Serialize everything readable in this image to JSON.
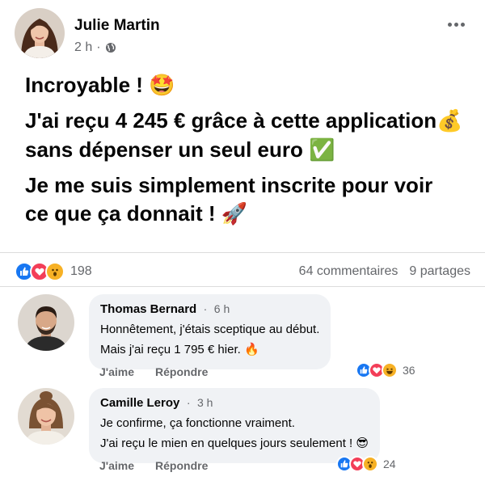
{
  "post": {
    "author": "Julie Martin",
    "time": "2 h",
    "separator": "·",
    "icons": {
      "privacy": "globe-icon",
      "menu": "more-options-icon"
    },
    "lines": [
      {
        "text": "Incroyable ! ",
        "emoji": "🤩"
      },
      {
        "text": "J'ai reçu 4 245 € grâce à cette application",
        "emoji": "💰"
      },
      {
        "text": "sans dépenser un seul euro ",
        "emoji": "✅"
      },
      {
        "text": "Je me suis simplement inscrite pour voir",
        "emoji": ""
      },
      {
        "text": "ce que ça donnait ! ",
        "emoji": "🚀"
      }
    ]
  },
  "reactions": {
    "icons": [
      "like-icon",
      "love-icon",
      "wow-icon"
    ],
    "count": "198",
    "comments": "64 commentaires",
    "shares": "9 partages"
  },
  "comments": [
    {
      "name": "Thomas Bernard",
      "time": "6 h",
      "separator": "·",
      "lines": [
        {
          "text": "Honnêtement, j'étais sceptique au début.",
          "emoji": ""
        },
        {
          "text": "Mais j'ai reçu 1 795 € hier. ",
          "emoji": "🔥"
        }
      ],
      "like_label": "J'aime",
      "reply_label": "Répondre",
      "reaction_icons": [
        "like-icon",
        "love-icon",
        "haha-icon"
      ],
      "reaction_count": "36"
    },
    {
      "name": "Camille Leroy",
      "time": "3 h",
      "separator": "·",
      "lines": [
        {
          "text": "Je confirme, ça fonctionne vraiment.",
          "emoji": ""
        },
        {
          "text": "J'ai reçu le mien en quelques jours seulement ! ",
          "emoji": "😎"
        }
      ],
      "like_label": "J'aime",
      "reply_label": "Répondre",
      "reaction_icons": [
        "like-icon",
        "love-icon",
        "wow-icon"
      ],
      "reaction_count": "24"
    }
  ],
  "colors": {
    "like": "#1877f2",
    "love": "#f33e58",
    "wow": "#f7b125",
    "secondary_text": "#65676b",
    "bubble": "#f0f2f5"
  }
}
